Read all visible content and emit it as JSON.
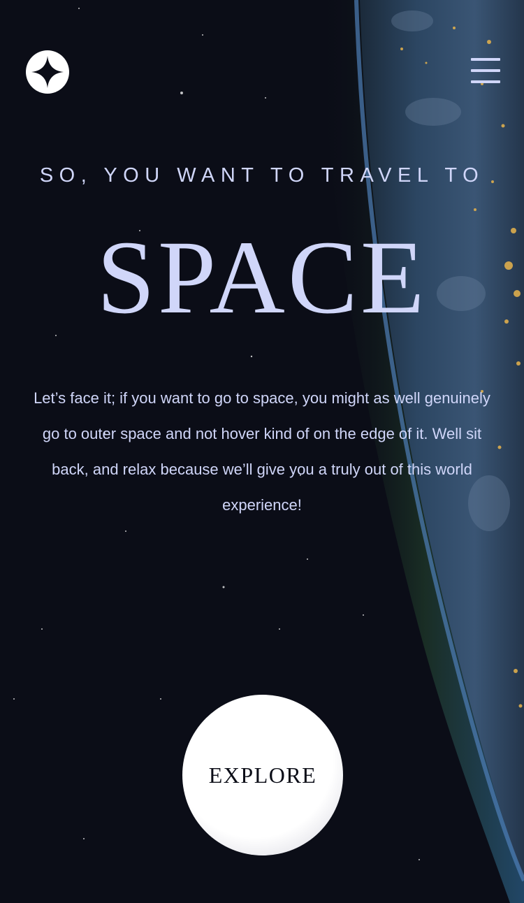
{
  "header": {
    "logo_icon": "star-logo-icon",
    "menu_icon": "hamburger-menu-icon"
  },
  "hero": {
    "eyebrow": "SO, YOU WANT TO TRAVEL TO",
    "headline": "SPACE",
    "body": "Let’s face it; if you want to go to space, you might as well genuinely go to outer space and not hover kind of on the edge of it. Well sit back, and relax because we’ll give you a truly out of this world experience!",
    "cta_label": "EXPLORE"
  },
  "colors": {
    "background": "#0b0d17",
    "accent_text": "#d0d6f9",
    "button": "#ffffff"
  }
}
